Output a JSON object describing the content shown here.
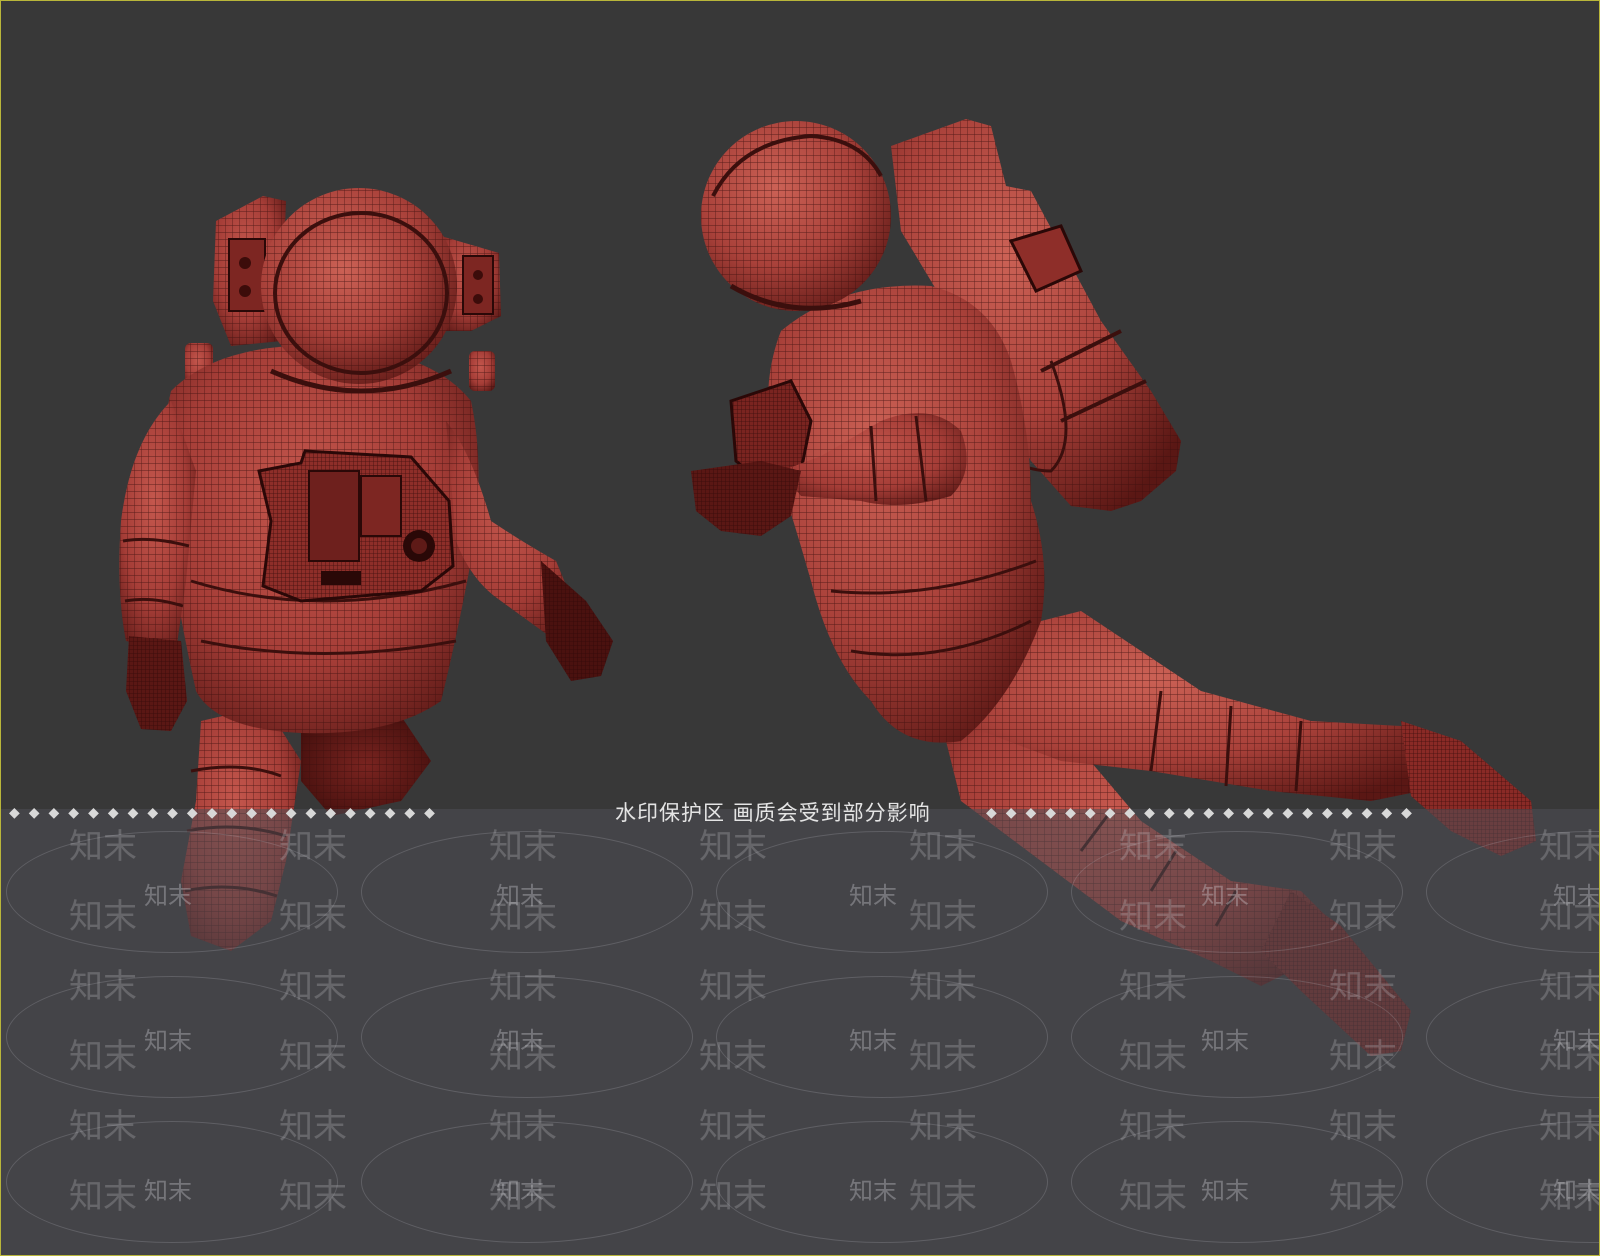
{
  "viewport": {
    "background": "#383838",
    "border_color": "#b9b63a"
  },
  "models": [
    {
      "name": "astronaut-front-view",
      "mesh_color": "#b0433d",
      "wire_color": "#3b0f0d"
    },
    {
      "name": "astronaut-side-view",
      "mesh_color": "#b0433d",
      "wire_color": "#3b0f0d"
    }
  ],
  "watermark": {
    "notice": "水印保护区   画质会受到部分影响",
    "dots": "◆◆◆◆◆◆◆◆◆◆◆◆◆◆◆◆◆◆◆◆◆◆",
    "brand": "知末"
  }
}
